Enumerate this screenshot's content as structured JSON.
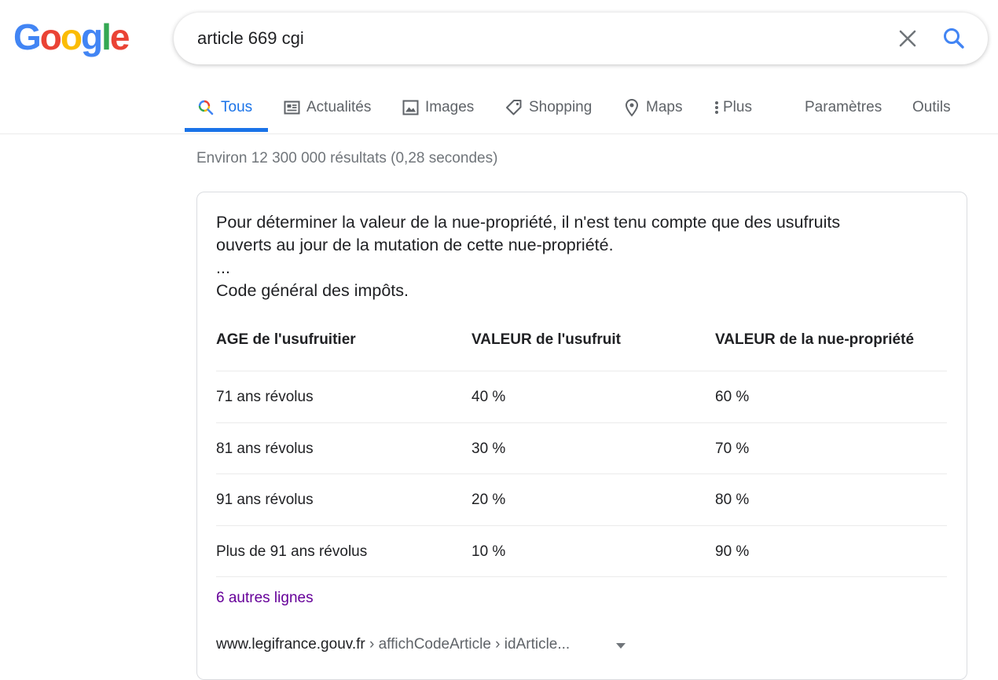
{
  "logo": {
    "letters": [
      "G",
      "o",
      "o",
      "g",
      "l",
      "e"
    ],
    "colors": [
      "#4285F4",
      "#EA4335",
      "#FBBC05",
      "#4285F4",
      "#34A853",
      "#EA4335"
    ]
  },
  "search": {
    "query": "article 669 cgi",
    "clear_icon": "close-icon",
    "search_icon": "search-icon"
  },
  "tabs": [
    {
      "label": "Tous",
      "icon": "search-icon",
      "active": true
    },
    {
      "label": "Actualités",
      "icon": "news-icon"
    },
    {
      "label": "Images",
      "icon": "image-icon"
    },
    {
      "label": "Shopping",
      "icon": "tag-icon"
    },
    {
      "label": "Maps",
      "icon": "map-pin-icon"
    },
    {
      "label": "Plus",
      "icon": "more-vert-icon"
    },
    {
      "label": "Paramètres"
    },
    {
      "label": "Outils"
    }
  ],
  "stats": "Environ 12 300 000 résultats (0,28 secondes)",
  "snippet": {
    "lines": [
      "Pour déterminer la valeur de la nue-propriété, il n'est tenu compte que des usufruits",
      "ouverts au jour de la mutation de cette nue-propriété.",
      "...",
      "Code général des impôts."
    ],
    "table": {
      "headers": [
        "AGE de l'usufruitier",
        "VALEUR de l'usufruit",
        "VALEUR de la nue-propriété"
      ],
      "rows": [
        [
          "71 ans révolus",
          "40 %",
          "60 %"
        ],
        [
          "81 ans révolus",
          "30 %",
          "70 %"
        ],
        [
          "91 ans révolus",
          "20 %",
          "80 %"
        ],
        [
          "Plus de 91 ans révolus",
          "10 %",
          "90 %"
        ]
      ]
    },
    "more_rows": "6 autres lignes",
    "cite": {
      "domain": "www.legifrance.gouv.fr",
      "path": " › affichCodeArticle › idArticle..."
    }
  },
  "colors": {
    "accent": "#1a73e8",
    "visited_link": "#660099"
  }
}
